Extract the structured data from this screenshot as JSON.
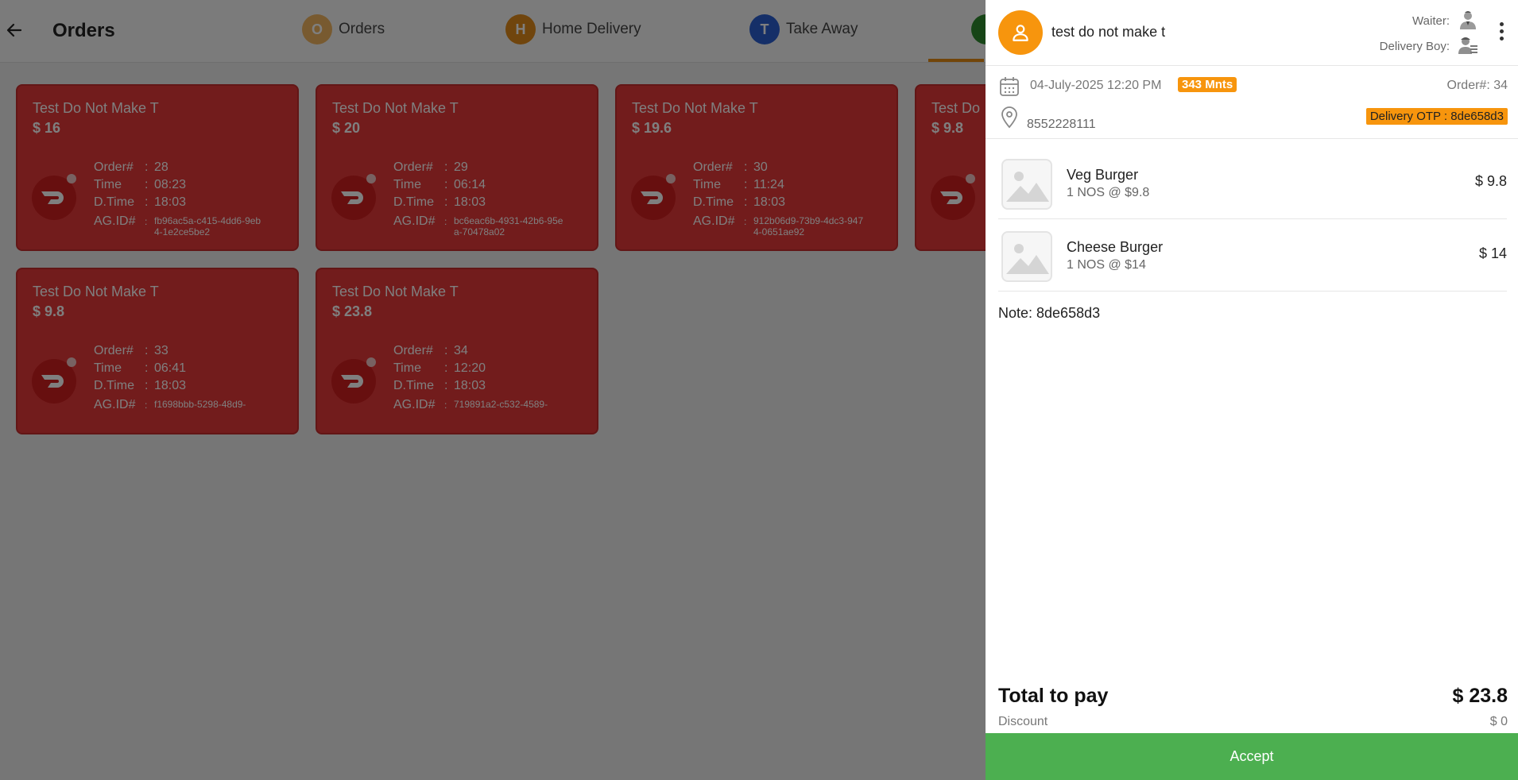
{
  "header": {
    "title": "Orders",
    "tabs": [
      {
        "initial": "O",
        "label": "Orders",
        "color": "#f0b561"
      },
      {
        "initial": "H",
        "label": "Home Delivery",
        "color": "#e08a1a"
      },
      {
        "initial": "T",
        "label": "Take Away",
        "color": "#2a5fd0"
      },
      {
        "initial": "",
        "label": "",
        "color": "#2e8b2e"
      }
    ]
  },
  "cards": [
    {
      "name": "Test Do Not Make T",
      "price": "$ 16",
      "order_label": "Order#",
      "order": "28",
      "time_label": "Time",
      "time": "08:23",
      "dtime_label": "D.Time",
      "dtime": "18:03",
      "agid_label": "AG.ID#",
      "agid": "fb96ac5a-c415-4dd6-9eb4-1e2ce5be2"
    },
    {
      "name": "Test Do Not Make T",
      "price": "$ 20",
      "order_label": "Order#",
      "order": "29",
      "time_label": "Time",
      "time": "06:14",
      "dtime_label": "D.Time",
      "dtime": "18:03",
      "agid_label": "AG.ID#",
      "agid": "bc6eac6b-4931-42b6-95ea-70478a02"
    },
    {
      "name": "Test Do Not Make T",
      "price": "$ 19.6",
      "order_label": "Order#",
      "order": "30",
      "time_label": "Time",
      "time": "11:24",
      "dtime_label": "D.Time",
      "dtime": "18:03",
      "agid_label": "AG.ID#",
      "agid": "912b06d9-73b9-4dc3-9474-0651ae92"
    },
    {
      "name": "Test Do",
      "price": "$ 9.8",
      "order_label": "",
      "order": "",
      "time_label": "",
      "time": "",
      "dtime_label": "",
      "dtime": "",
      "agid_label": "",
      "agid": ""
    },
    {
      "name": "Test Do Not Make T",
      "price": "$ 9.8",
      "order_label": "Order#",
      "order": "33",
      "time_label": "Time",
      "time": "06:41",
      "dtime_label": "D.Time",
      "dtime": "18:03",
      "agid_label": "AG.ID#",
      "agid": "f1698bbb-5298-48d9-"
    },
    {
      "name": "Test Do Not Make T",
      "price": "$ 23.8",
      "order_label": "Order#",
      "order": "34",
      "time_label": "Time",
      "time": "12:20",
      "dtime_label": "D.Time",
      "dtime": "18:03",
      "agid_label": "AG.ID#",
      "agid": "719891a2-c532-4589-"
    }
  ],
  "panel": {
    "customer_name": "test do not make t",
    "waiter_label": "Waiter:",
    "delivery_boy_label": "Delivery Boy:",
    "date": "04-July-2025 12:20 PM",
    "minutes_badge": "343 Mnts",
    "order_no": "Order#: 34",
    "phone": "8552228111",
    "otp": "Delivery OTP : 8de658d3",
    "items": [
      {
        "name": "Veg Burger",
        "qty": "1 NOS @ $9.8",
        "price": "$ 9.8"
      },
      {
        "name": "Cheese Burger",
        "qty": "1 NOS @ $14",
        "price": "$ 14"
      }
    ],
    "note": "Note: 8de658d3",
    "total_label": "Total to pay",
    "total_value": "$ 23.8",
    "discount_label": "Discount",
    "discount_value": "$ 0",
    "accept_label": "Accept"
  },
  "colors": {
    "card_red": "#e53939",
    "accent_orange": "#f7950d",
    "accept_green": "#4caf50"
  }
}
